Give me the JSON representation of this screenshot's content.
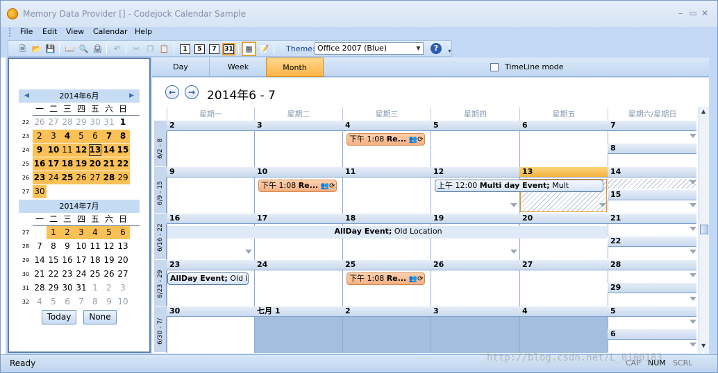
{
  "window": {
    "title": "Memory Data Provider [] -  Codejock Calendar Sample"
  },
  "menu": [
    "File",
    "Edit",
    "View",
    "Calendar",
    "Help"
  ],
  "toolbar": {
    "day_buttons": [
      "1",
      "5",
      "7",
      "31"
    ],
    "theme_label": "Theme:",
    "theme_value": "Office 2007 (Blue)"
  },
  "mini_calendars": [
    {
      "header": "2014年6月",
      "dow": [
        "一",
        "二",
        "三",
        "四",
        "五",
        "六",
        "日"
      ],
      "weeks": [
        {
          "wk": "22",
          "days": [
            {
              "d": "26",
              "cls": "gray"
            },
            {
              "d": "27",
              "cls": "gray"
            },
            {
              "d": "28",
              "cls": "gray"
            },
            {
              "d": "29",
              "cls": "gray"
            },
            {
              "d": "30",
              "cls": "gray"
            },
            {
              "d": "31",
              "cls": "gray"
            },
            {
              "d": "1",
              "cls": "bold"
            }
          ]
        },
        {
          "wk": "23",
          "days": [
            {
              "d": "2",
              "cls": "hl"
            },
            {
              "d": "3",
              "cls": "hl"
            },
            {
              "d": "4",
              "cls": "hl bold"
            },
            {
              "d": "5",
              "cls": "hl"
            },
            {
              "d": "6",
              "cls": "hl"
            },
            {
              "d": "7",
              "cls": "hl bold"
            },
            {
              "d": "8",
              "cls": "hl bold"
            }
          ]
        },
        {
          "wk": "24",
          "days": [
            {
              "d": "9",
              "cls": "hl bold"
            },
            {
              "d": "10",
              "cls": "hl bold"
            },
            {
              "d": "11",
              "cls": "hl"
            },
            {
              "d": "12",
              "cls": "hl bold"
            },
            {
              "d": "13",
              "cls": "hl bold today"
            },
            {
              "d": "14",
              "cls": "hl bold"
            },
            {
              "d": "15",
              "cls": "hl bold"
            }
          ]
        },
        {
          "wk": "25",
          "days": [
            {
              "d": "16",
              "cls": "hl bold"
            },
            {
              "d": "17",
              "cls": "hl bold"
            },
            {
              "d": "18",
              "cls": "hl bold"
            },
            {
              "d": "19",
              "cls": "hl bold"
            },
            {
              "d": "20",
              "cls": "hl bold"
            },
            {
              "d": "21",
              "cls": "hl bold"
            },
            {
              "d": "22",
              "cls": "hl bold"
            }
          ]
        },
        {
          "wk": "26",
          "days": [
            {
              "d": "23",
              "cls": "hl bold"
            },
            {
              "d": "24",
              "cls": "hl"
            },
            {
              "d": "25",
              "cls": "hl bold"
            },
            {
              "d": "26",
              "cls": "hl"
            },
            {
              "d": "27",
              "cls": "hl"
            },
            {
              "d": "28",
              "cls": "hl bold"
            },
            {
              "d": "29",
              "cls": "hl"
            }
          ]
        },
        {
          "wk": "27",
          "days": [
            {
              "d": "30",
              "cls": "hl"
            }
          ]
        }
      ]
    },
    {
      "header": "2014年7月",
      "dow": [
        "一",
        "二",
        "三",
        "四",
        "五",
        "六",
        "日"
      ],
      "weeks": [
        {
          "wk": "27",
          "days": [
            {
              "d": "",
              "cls": ""
            },
            {
              "d": "1",
              "cls": "hl"
            },
            {
              "d": "2",
              "cls": "hl"
            },
            {
              "d": "3",
              "cls": "hl"
            },
            {
              "d": "4",
              "cls": "hl"
            },
            {
              "d": "5",
              "cls": "hl"
            },
            {
              "d": "6",
              "cls": "hl"
            }
          ]
        },
        {
          "wk": "28",
          "days": [
            {
              "d": "7",
              "cls": ""
            },
            {
              "d": "8",
              "cls": ""
            },
            {
              "d": "9",
              "cls": ""
            },
            {
              "d": "10",
              "cls": ""
            },
            {
              "d": "11",
              "cls": ""
            },
            {
              "d": "12",
              "cls": ""
            },
            {
              "d": "13",
              "cls": ""
            }
          ]
        },
        {
          "wk": "29",
          "days": [
            {
              "d": "14",
              "cls": ""
            },
            {
              "d": "15",
              "cls": ""
            },
            {
              "d": "16",
              "cls": ""
            },
            {
              "d": "17",
              "cls": ""
            },
            {
              "d": "18",
              "cls": ""
            },
            {
              "d": "19",
              "cls": ""
            },
            {
              "d": "20",
              "cls": ""
            }
          ]
        },
        {
          "wk": "30",
          "days": [
            {
              "d": "21",
              "cls": ""
            },
            {
              "d": "22",
              "cls": ""
            },
            {
              "d": "23",
              "cls": ""
            },
            {
              "d": "24",
              "cls": ""
            },
            {
              "d": "25",
              "cls": ""
            },
            {
              "d": "26",
              "cls": ""
            },
            {
              "d": "27",
              "cls": ""
            }
          ]
        },
        {
          "wk": "31",
          "days": [
            {
              "d": "28",
              "cls": ""
            },
            {
              "d": "29",
              "cls": ""
            },
            {
              "d": "30",
              "cls": ""
            },
            {
              "d": "31",
              "cls": ""
            },
            {
              "d": "1",
              "cls": "gray"
            },
            {
              "d": "2",
              "cls": "gray"
            },
            {
              "d": "3",
              "cls": "gray"
            }
          ]
        },
        {
          "wk": "32",
          "days": [
            {
              "d": "4",
              "cls": "gray"
            },
            {
              "d": "5",
              "cls": "gray"
            },
            {
              "d": "6",
              "cls": "gray"
            },
            {
              "d": "7",
              "cls": "gray"
            },
            {
              "d": "8",
              "cls": "gray"
            },
            {
              "d": "9",
              "cls": "gray"
            },
            {
              "d": "10",
              "cls": "gray"
            }
          ]
        }
      ]
    }
  ],
  "mini_buttons": {
    "today": "Today",
    "none": "None"
  },
  "view_tabs": {
    "day": "Day",
    "week": "Week",
    "month": "Month",
    "timeline": "TimeLine mode"
  },
  "calendar": {
    "title": "2014年6 - 7",
    "dow_headers": [
      "星期一",
      "星期二",
      "星期三",
      "星期四",
      "星期五",
      "星期六/星期日"
    ],
    "weeks": [
      {
        "label": "6/2 - 8",
        "days": [
          "2",
          "3",
          "4",
          "5",
          "6"
        ],
        "sat": "7",
        "sun": "8"
      },
      {
        "label": "6/9 - 15",
        "days": [
          "9",
          "10",
          "11",
          "12",
          "13"
        ],
        "sat": "14",
        "sun": "15"
      },
      {
        "label": "6/16 - 22",
        "days": [
          "16",
          "17",
          "18",
          "19",
          "20"
        ],
        "sat": "21",
        "sun": "22"
      },
      {
        "label": "6/23 - 29",
        "days": [
          "23",
          "24",
          "25",
          "26",
          "27"
        ],
        "sat": "28",
        "sun": "29"
      },
      {
        "label": "6/30 - 7/",
        "days": [
          "30",
          "七月 1",
          "2",
          "3",
          "4"
        ],
        "sat": "5",
        "sun": "6"
      }
    ],
    "events": {
      "e1": {
        "time": "下午 1:08",
        "subject": "Re..."
      },
      "e2": {
        "time": "下午 1:08",
        "subject": "Re..."
      },
      "e3": {
        "time": "上午 12:00",
        "subject": "Multi day Event;",
        "location": "Mult"
      },
      "e4": {
        "subject": "AllDay Event;",
        "location": "Old Location"
      },
      "e5": {
        "subject": "AllDay Event;",
        "location": "Old l"
      },
      "e6": {
        "time": "下午 1:08",
        "subject": "Re..."
      }
    }
  },
  "status": {
    "ready": "Ready",
    "cap": "CAP",
    "num": "NUM",
    "scrl": "SCRL"
  },
  "watermark": "http://blog.csdn.net/L_0100183"
}
